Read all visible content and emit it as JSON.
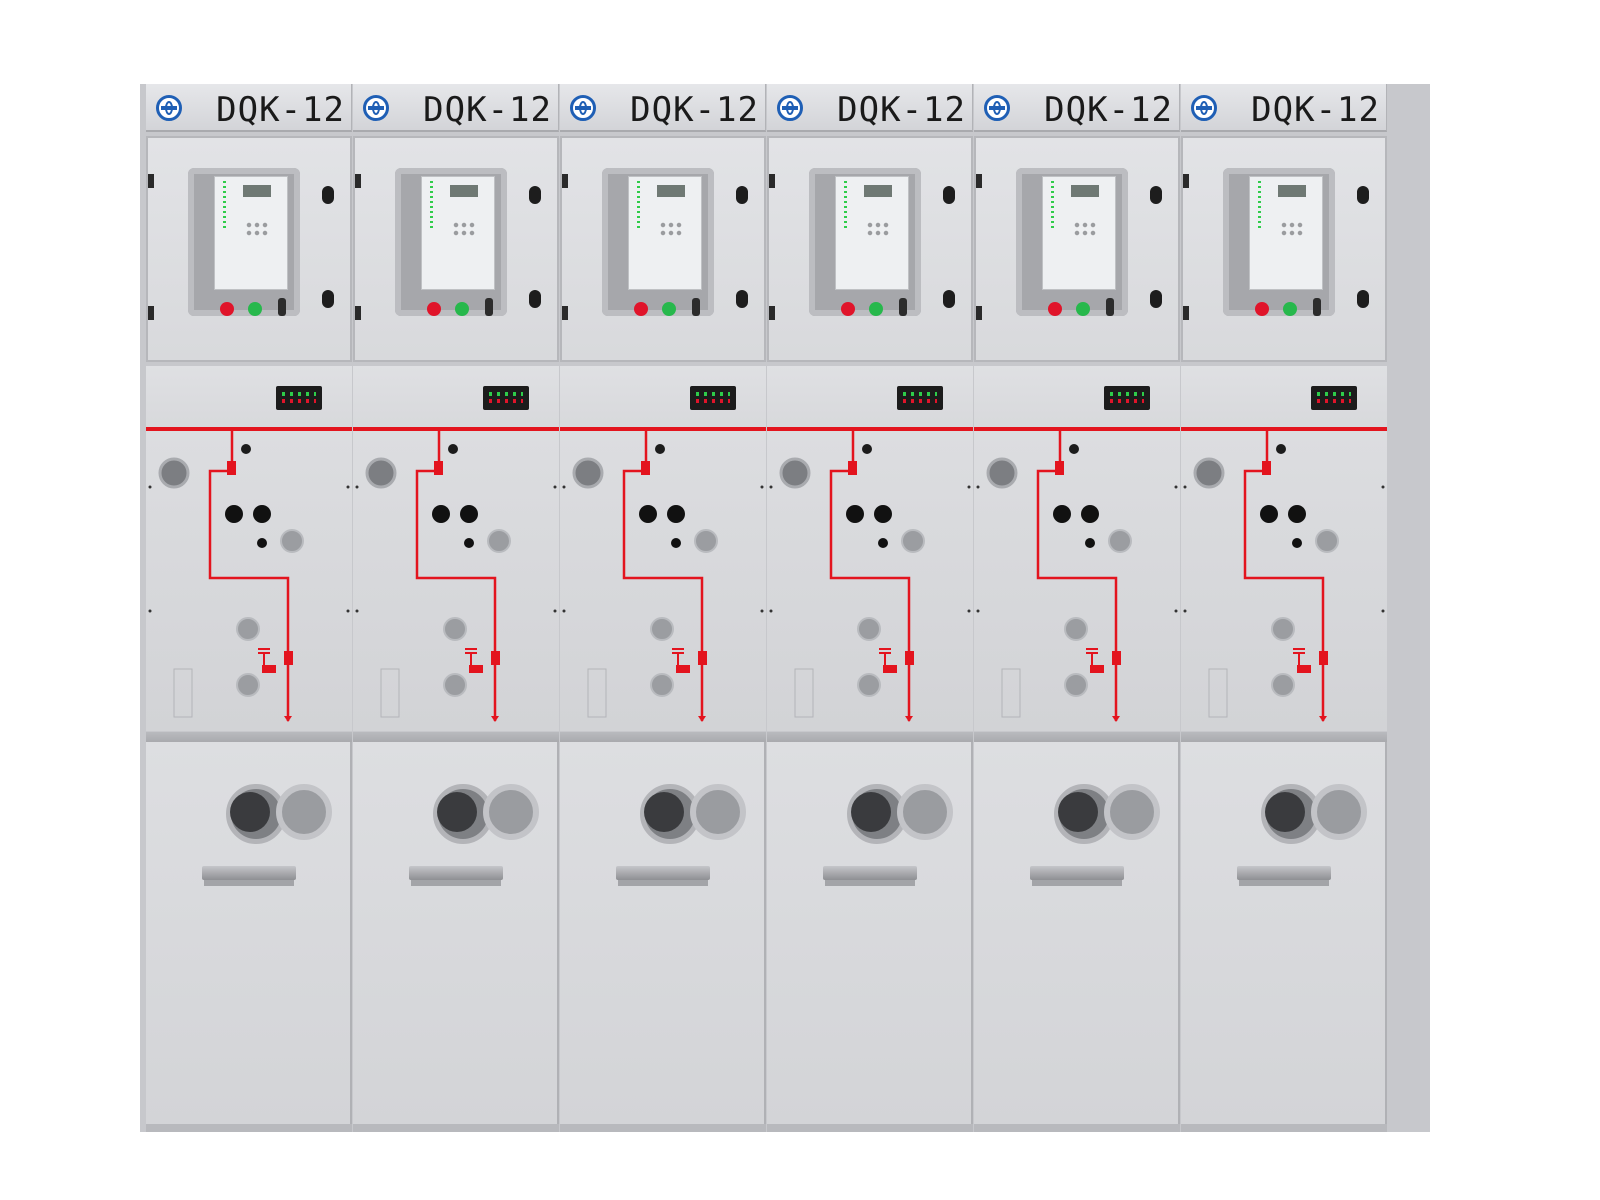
{
  "switchgear": {
    "model_label": "DQK-12",
    "cabinets": [
      {
        "label": "DQK-12"
      },
      {
        "label": "DQK-12"
      },
      {
        "label": "DQK-12"
      },
      {
        "label": "DQK-12"
      },
      {
        "label": "DQK-12"
      },
      {
        "label": "DQK-12"
      }
    ]
  },
  "colors": {
    "panel": "#d9dadd",
    "busbar": "#e3141e",
    "logo": "#1f5fb5",
    "indicator_on": "#2ecc4a",
    "indicator_off": "#e0142a"
  },
  "icons": [
    "manufacturer-logo-icon",
    "close-button-red",
    "open-button-green",
    "door-lock-icon",
    "cable-entry-icon"
  ]
}
